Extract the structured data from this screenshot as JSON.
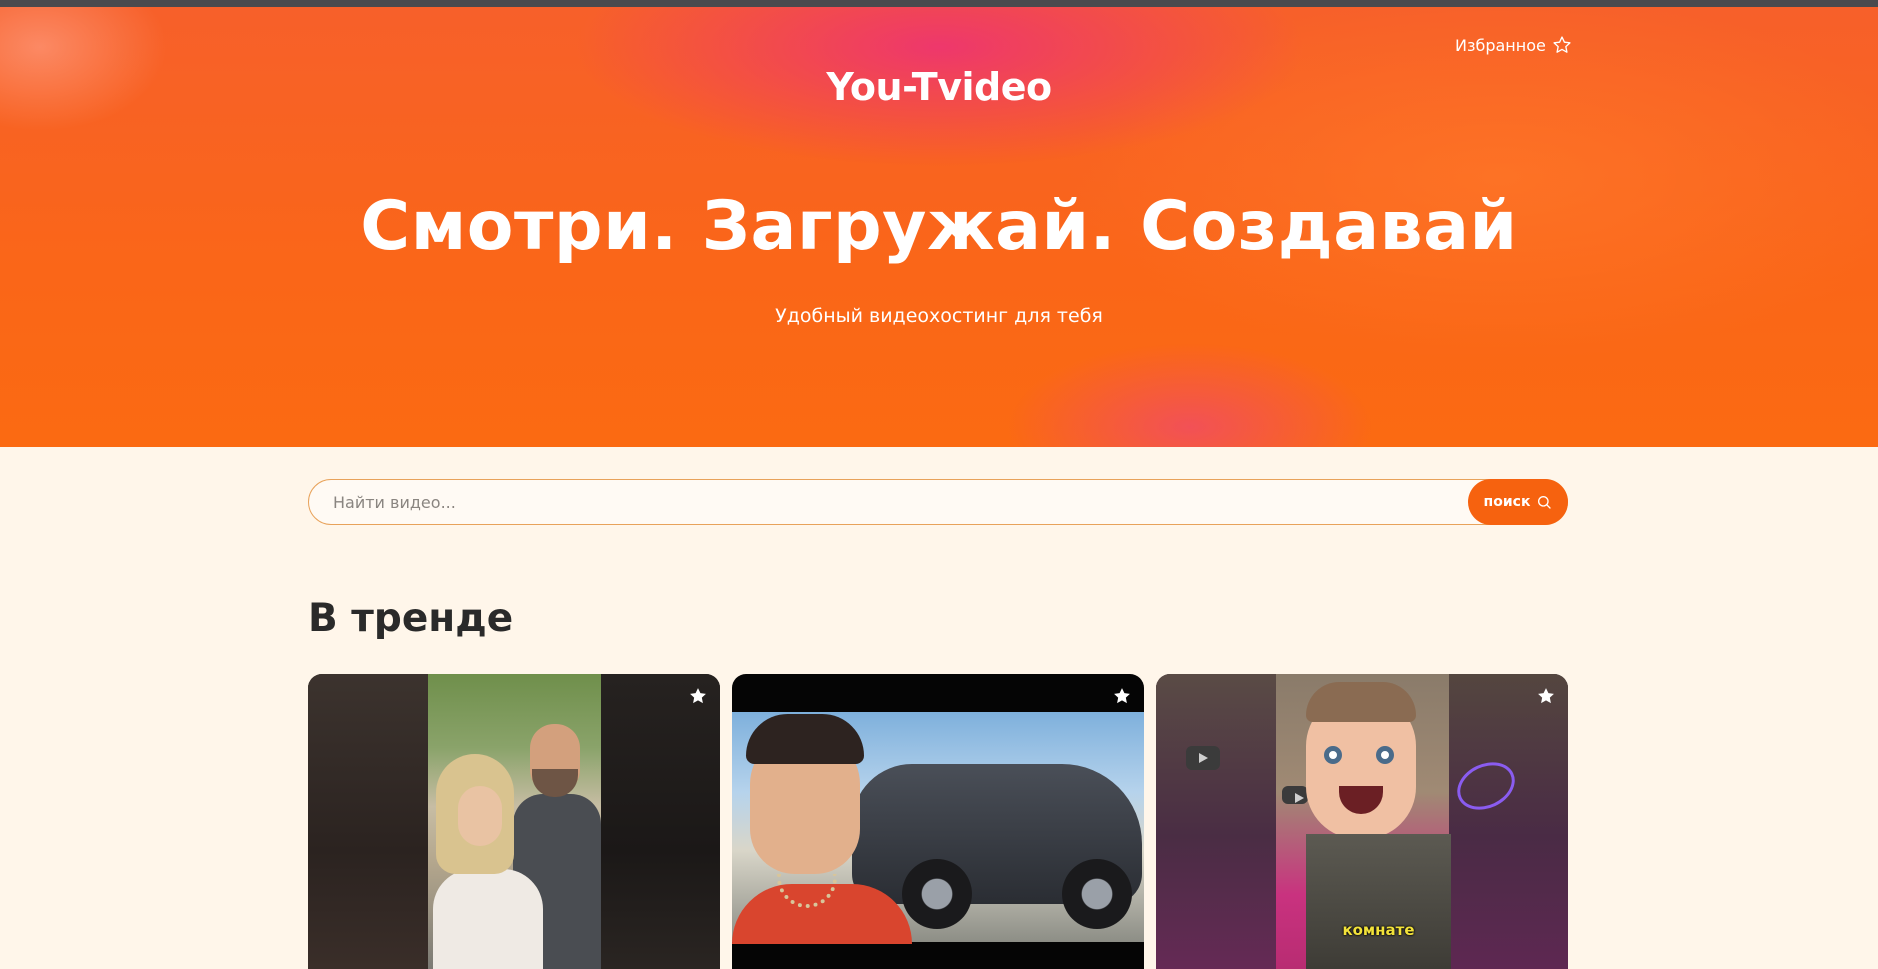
{
  "header": {
    "favorites_label": "Избранное",
    "logo_text": "You-Tvideo",
    "headline": "Смотри. Загружай. Создавай",
    "tagline": "Удобный видеохостинг для тебя"
  },
  "search": {
    "placeholder": "Найти видео...",
    "button_label": "поиск"
  },
  "trending": {
    "title": "В тренде",
    "cards": [
      {
        "caption": ""
      },
      {
        "caption": ""
      },
      {
        "caption": "комнате"
      }
    ]
  },
  "colors": {
    "accent": "#f6620f",
    "page_bg": "#fff6ea",
    "heading": "#2a2a2a"
  }
}
